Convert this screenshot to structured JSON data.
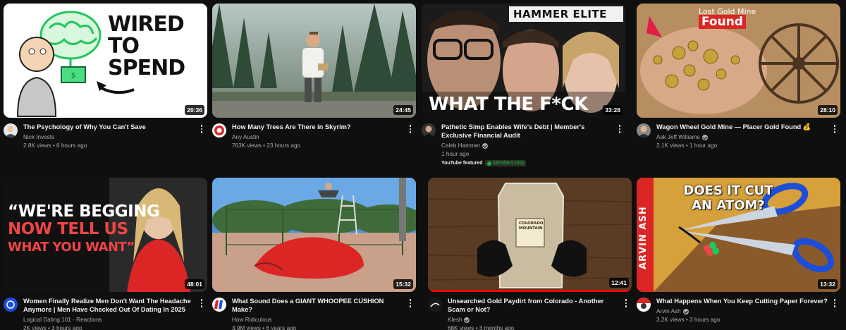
{
  "videos": [
    {
      "title": "The Psychology of Why You Can't Save",
      "channel": "Nick Invests",
      "stats": "2.8K views • 6 hours ago",
      "duration": "20:36",
      "thumb_text": [
        "WIRED",
        "TO SPEND"
      ]
    },
    {
      "title": "How Many Trees Are There in Skyrim?",
      "channel": "Any Austin",
      "stats": "763K views • 23 hours ago",
      "duration": "24:45"
    },
    {
      "title": "Pathetic Simp Enables Wife's Debt | Member's Exclusive Financial Audit",
      "channel": "Caleb Hammer",
      "stats": "1 hour ago",
      "duration": "33:28",
      "thumb_text": [
        "HAMMER ELITE",
        "WHAT THE F*CK"
      ],
      "badge_featured": "YouTube featured",
      "badge_members": "Members only"
    },
    {
      "title": "Wagon Wheel Gold Mine — Placer Gold Found 💰",
      "channel": "Ask Jeff Williams",
      "stats": "2.1K views • 1 hour ago",
      "duration": "28:10",
      "thumb_text": [
        "Lost Gold Mine",
        "Found"
      ]
    },
    {
      "title": "Women Finally Realize Men Don't Want The Headache Anymore | Men Have Checked Out Of Dating In 2025",
      "channel": "Logical Dating 101 - Reactions",
      "stats": "2K views • 3 hours ago",
      "duration": "48:01",
      "thumb_text": [
        "“WE'RE BEGGING",
        "NOW TELL US",
        "WHAT YOU WANT”"
      ]
    },
    {
      "title": "What Sound Does a GIANT WHOOPEE CUSHION Make?",
      "channel": "How Ridiculous",
      "stats": "3.9M views • 6 years ago",
      "duration": "15:32"
    },
    {
      "title": "Unsearched Gold Paydirt from Colorado - Another Scam or Not?",
      "channel": "Klesh",
      "stats": "68K views • 3 months ago",
      "duration": "12:41",
      "thumb_text": [
        "COLORADO",
        "MOUNTAIN"
      ]
    },
    {
      "title": "What Happens When You Keep Cutting Paper Forever?",
      "channel": "Arvin Ash",
      "stats": "3.2K views • 3 hours ago",
      "duration": "13:32",
      "thumb_text": [
        "DOES IT CUT",
        "AN ATOM?",
        "ARVIN ASH"
      ]
    }
  ],
  "colors": {
    "background": "#0f0f0f",
    "title": "#f1f1f1",
    "secondary": "#aaaaaa",
    "progress": "#ff0000"
  },
  "progress": {
    "video_7": 1.0
  }
}
